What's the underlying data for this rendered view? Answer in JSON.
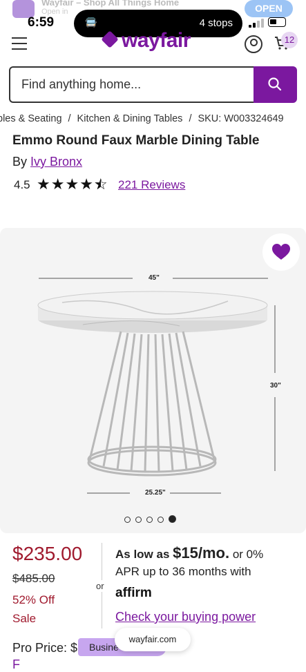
{
  "app_banner": {
    "name": "Wayfair – Shop All Things Home",
    "subtitle": "Open in",
    "open_label": "OPEN"
  },
  "status_bar": {
    "time": "6:59",
    "island_text": "4 stops"
  },
  "header": {
    "logo": "wayfair",
    "cart_count": "12"
  },
  "search": {
    "placeholder": "Find anything home..."
  },
  "breadcrumb": {
    "items": [
      "bles & Seating",
      "Kitchen & Dining Tables",
      "SKU: W003324649"
    ]
  },
  "product": {
    "title": "Emmo Round Faux Marble Dining Table",
    "by_prefix": "By",
    "brand": "Ivy Bronx",
    "rating": "4.5",
    "stars": 4.5,
    "reviews": "221 Reviews"
  },
  "image": {
    "dim_width": "45\"",
    "dim_height": "30\"",
    "dim_base": "25.25\"",
    "carousel_count": 5,
    "carousel_active": 5
  },
  "pricing": {
    "price": "$235.00",
    "original_price": "$485.00",
    "discount": "52% Off",
    "sale": "Sale",
    "or": "or",
    "finance_prefix": "As low as",
    "finance_amount": "$15/mo.",
    "finance_suffix": "or 0%",
    "finance_line2": "APR up to 36 months with",
    "affirm": "affirm",
    "buying_power": "Check your buying power"
  },
  "pro": {
    "label": "Pro Price:",
    "value": "$",
    "tag": "Busine"
  },
  "url_pill": "wayfair.com",
  "bottom_text": "F"
}
